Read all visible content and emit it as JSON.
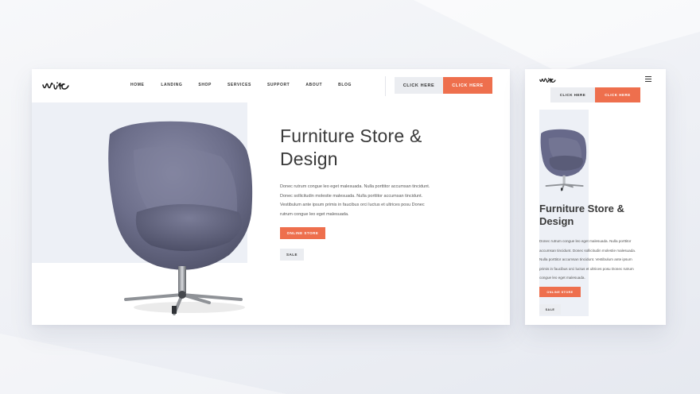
{
  "desktop": {
    "logo_text": "wire",
    "nav": [
      {
        "label": "HOME"
      },
      {
        "label": "LANDING"
      },
      {
        "label": "SHOP"
      },
      {
        "label": "SERVICES"
      },
      {
        "label": "SUPPORT"
      },
      {
        "label": "ABOUT"
      },
      {
        "label": "BLOG"
      }
    ],
    "btn_secondary": "CLICK HERE",
    "btn_primary": "CLICK HERE",
    "title_line1": "Furniture Store &",
    "title_line2": "Design",
    "body_lines": [
      "Donec rutrum congue leo eget malesuada. Nulla porttitor accumsan tincidunt.",
      "Donec sollicitudin molestie malesuada. Nulla porttitor accumsan tincidunt.",
      "Vestibulum ante ipsum primis in faucibus orci luctus et ultrices posu Donec",
      "rutrum congue leo eget malesuada."
    ],
    "btn_online": "ONLINE STORE",
    "btn_sale": "SALE"
  },
  "mobile": {
    "logo_text": "wire",
    "btn_secondary": "CLICK HERE",
    "btn_primary": "CLICK HERE",
    "title_line1": "Furniture Store &",
    "title_line2": "Design",
    "body_lines": [
      "Donec rutrum congue leo eget malesuada. Nulla porttitor",
      "accumsan tincidunt. Donec sollicitudin molestie malesuada.",
      "Nulla porttitor accumsan tincidunt. Vestibulum ante ipsum",
      "primis in faucibus orci luctus et ultrices posu Donec rutrum",
      "congue leo eget malesuada."
    ],
    "btn_online": "ONLINE STORE",
    "btn_sale": "SALE"
  },
  "colors": {
    "accent": "#ee6f4d",
    "secondary_button": "#ebedf1",
    "hero_panel": "#edf0f6",
    "text_dark": "#3a3a3a"
  },
  "icons": {
    "logo": "wire-script-logo",
    "chair": "swivel-chair-image",
    "menu": "hamburger-menu-icon"
  }
}
